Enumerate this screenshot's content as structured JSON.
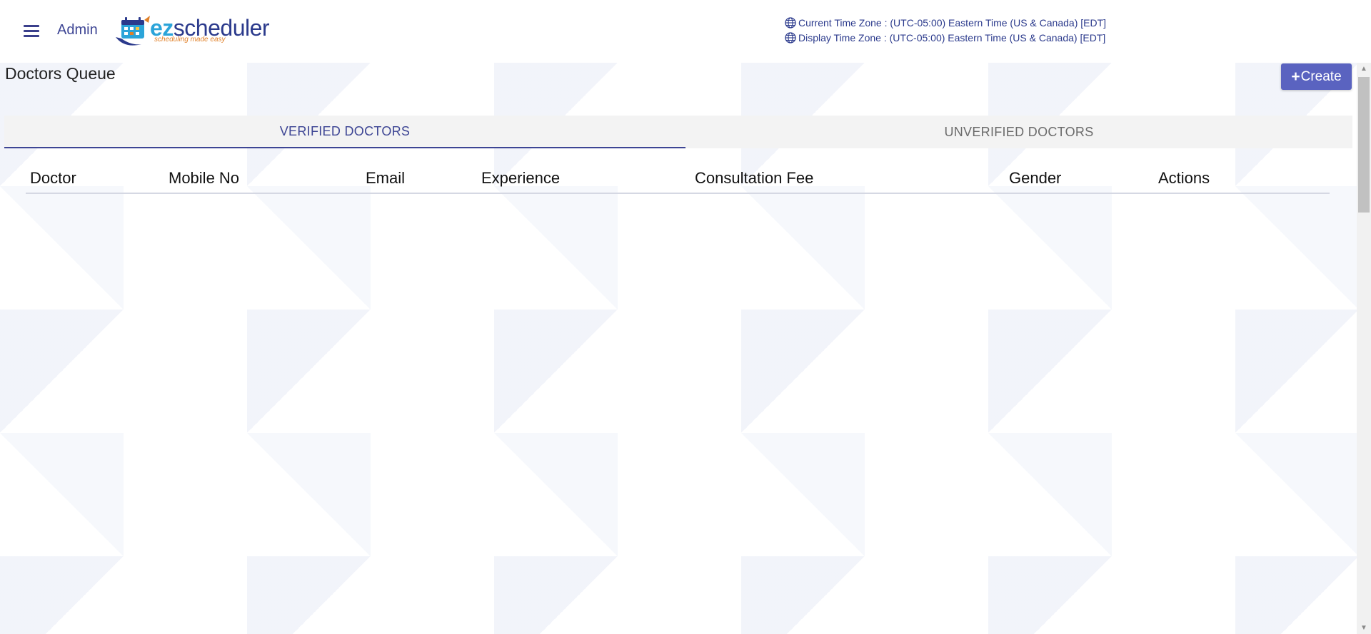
{
  "header": {
    "user_label": "Admin",
    "logo": {
      "brand_prefix": "ez",
      "brand_suffix": "scheduler",
      "tagline": "scheduling made easy"
    },
    "current_time_zone": "Current Time Zone : (UTC-05:00) Eastern Time (US & Canada) [EDT]",
    "display_time_zone": "Display Time Zone : (UTC-05:00) Eastern Time (US & Canada) [EDT]"
  },
  "page": {
    "title": "Doctors Queue",
    "create_label": "Create"
  },
  "tabs": [
    {
      "label": "VERIFIED DOCTORS",
      "active": true
    },
    {
      "label": "UNVERIFIED DOCTORS",
      "active": false
    }
  ],
  "table": {
    "columns": [
      "Doctor",
      "Mobile No",
      "Email",
      "Experience",
      "Consultation Fee",
      "Gender",
      "Actions"
    ],
    "rows": []
  },
  "colors": {
    "primary": "#3d4594",
    "button": "#5a63c0",
    "logo_blue": "#2ba4d9",
    "logo_orange": "#e0812a"
  },
  "icons": {
    "menu": "hamburger-menu-icon",
    "timezone": "globe-icon",
    "create": "plus-icon"
  }
}
